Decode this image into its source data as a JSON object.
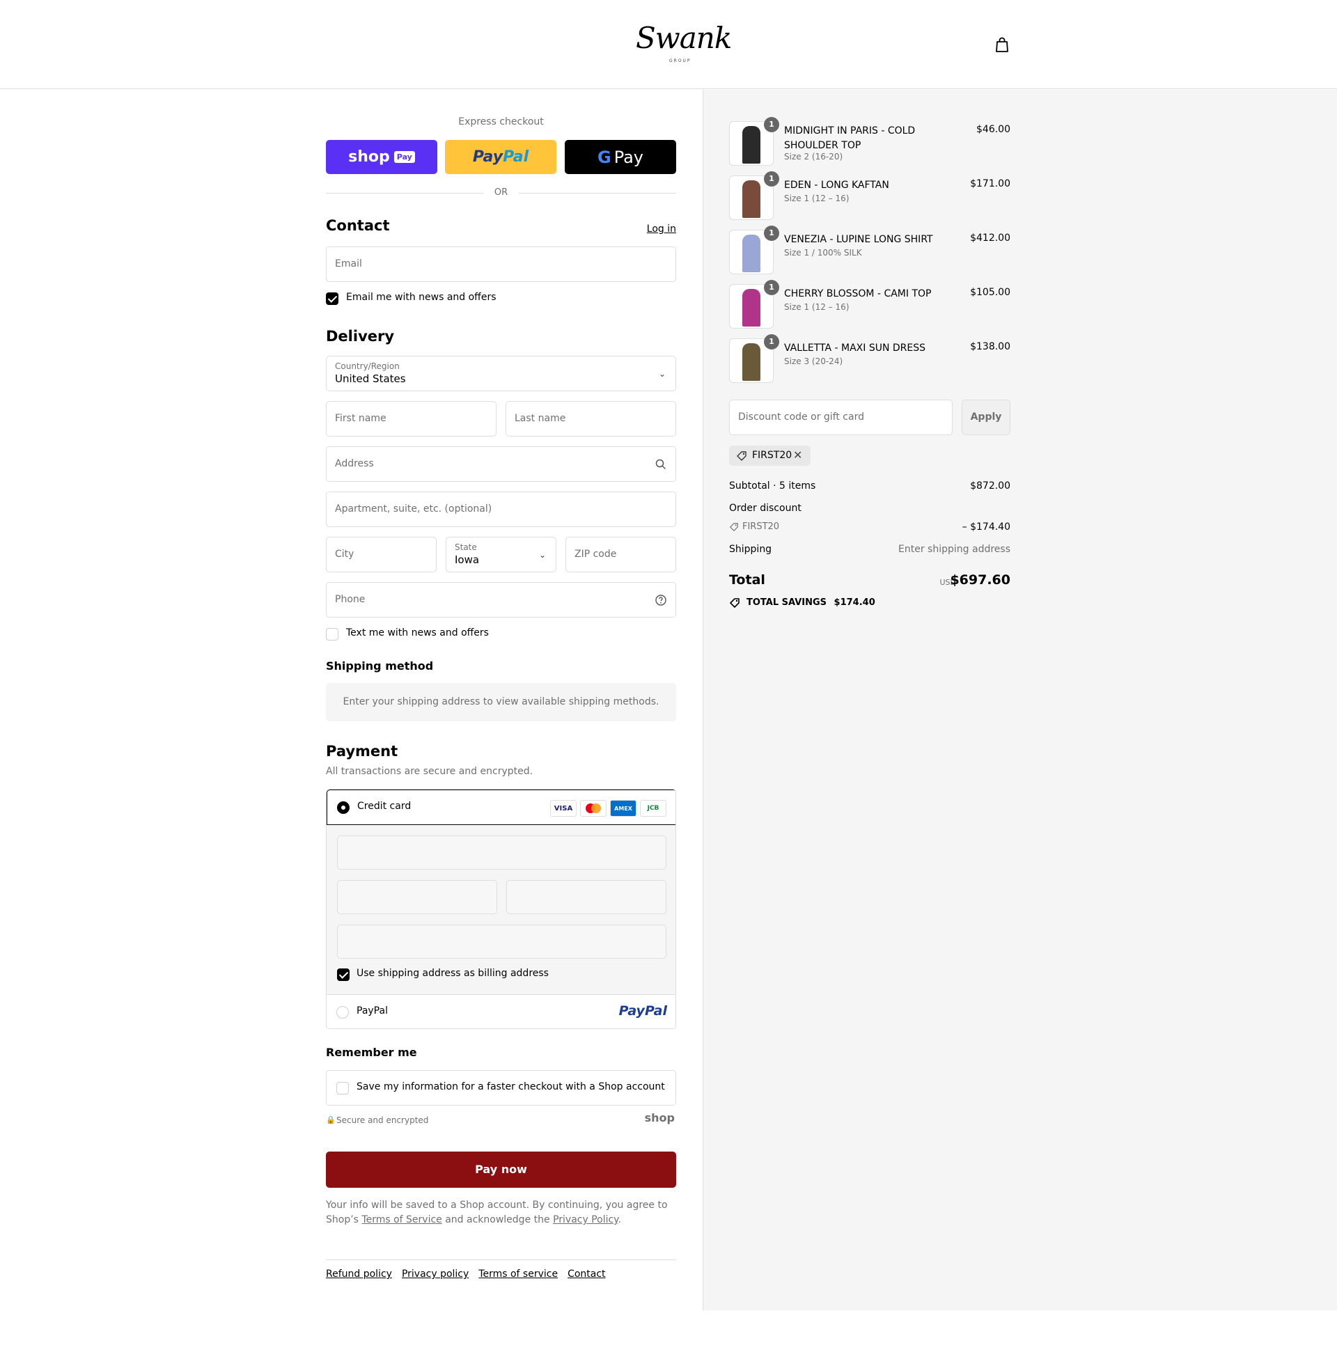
{
  "header": {
    "logo_text": "Swank",
    "logo_subtext": "GROUP"
  },
  "express": {
    "label": "Express checkout",
    "shoppay_label": "shop",
    "shoppay_pill": "Pay",
    "paypal_part1": "Pay",
    "paypal_part2": "Pal",
    "gpay_g": "G",
    "gpay_label": "Pay",
    "or_label": "OR"
  },
  "contact": {
    "heading": "Contact",
    "login_link": "Log in",
    "email_placeholder": "Email",
    "news_label": "Email me with news and offers",
    "news_checked": true
  },
  "delivery": {
    "heading": "Delivery",
    "country_label": "Country/Region",
    "country_value": "United States",
    "first_name_placeholder": "First name",
    "last_name_placeholder": "Last name",
    "address_placeholder": "Address",
    "apartment_placeholder": "Apartment, suite, etc. (optional)",
    "city_placeholder": "City",
    "state_label": "State",
    "state_value": "Iowa",
    "zip_placeholder": "ZIP code",
    "phone_placeholder": "Phone",
    "text_label": "Text me with news and offers"
  },
  "shipping_method": {
    "heading": "Shipping method",
    "note": "Enter your shipping address to view available shipping methods."
  },
  "payment": {
    "heading": "Payment",
    "subtitle": "All transactions are secure and encrypted.",
    "credit_card_label": "Credit card",
    "cards": [
      "VISA",
      "MC",
      "AMEX",
      "JCB"
    ],
    "billing_label": "Use shipping address as billing address",
    "paypal_label": "PayPal",
    "paypal_logo": "PayPal"
  },
  "remember": {
    "heading": "Remember me",
    "label": "Save my information for a faster checkout with a Shop account",
    "secure_label": "Secure and encrypted",
    "shop_logo": "shop"
  },
  "pay_now_label": "Pay now",
  "legal": {
    "text1": "Your info will be saved to a Shop account. By continuing, you agree to Shop’s ",
    "terms": "Terms of Service",
    "text2": " and acknowledge the ",
    "privacy": "Privacy Policy",
    "text3": "."
  },
  "footer": {
    "links": [
      "Refund policy",
      "Privacy policy",
      "Terms of service",
      "Contact"
    ]
  },
  "cart": {
    "items": [
      {
        "qty": "1",
        "name": "MIDNIGHT IN PARIS - COLD SHOULDER TOP",
        "variant": "Size 2 (16-20)",
        "price": "$46.00",
        "color": "#2a2a2a"
      },
      {
        "qty": "1",
        "name": "EDEN - LONG KAFTAN",
        "variant": "Size 1 (12 – 16)",
        "price": "$171.00",
        "color": "#7a4a3a"
      },
      {
        "qty": "1",
        "name": "VENEZIA - LUPINE LONG SHIRT",
        "variant": "Size 1 / 100% SILK",
        "price": "$412.00",
        "color": "#9aa6d6"
      },
      {
        "qty": "1",
        "name": "CHERRY BLOSSOM - CAMI TOP",
        "variant": "Size 1 (12 – 16)",
        "price": "$105.00",
        "color": "#b0358a"
      },
      {
        "qty": "1",
        "name": "VALLETTA - MAXI SUN DRESS",
        "variant": "Size 3 (20-24)",
        "price": "$138.00",
        "color": "#6b5a3a"
      }
    ],
    "discount_placeholder": "Discount code or gift card",
    "apply_label": "Apply",
    "applied_code": "FIRST20",
    "subtotal_label": "Subtotal · 5 items",
    "subtotal_value": "$872.00",
    "order_discount_label": "Order discount",
    "discount_code": "FIRST20",
    "discount_value": "– $174.40",
    "shipping_label": "Shipping",
    "shipping_value": "Enter shipping address",
    "total_label": "Total",
    "currency": "USD",
    "total_value": "$697.60",
    "savings_label": "TOTAL SAVINGS",
    "savings_value": "$174.40"
  },
  "colors": {
    "pay_now": "#8b0e11",
    "shoppay": "#5a31f4",
    "paypal": "#ffc439"
  }
}
